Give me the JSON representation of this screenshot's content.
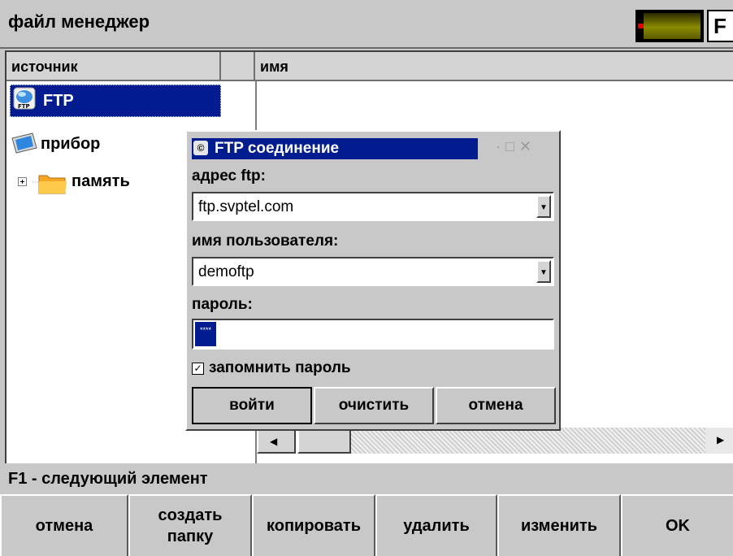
{
  "app": {
    "title": "файл менеджер",
    "f_key": "F"
  },
  "columns": {
    "source": "источник",
    "name": "имя"
  },
  "tree": [
    {
      "label": "FTP",
      "icon": "ftp-icon",
      "selected": true
    },
    {
      "label": "прибор",
      "icon": "device-icon",
      "selected": false
    },
    {
      "label": "память",
      "icon": "folder-icon",
      "expander": "+",
      "selected": false
    }
  ],
  "status_line": "F1 - следующий элемент",
  "fkeys": [
    "отмена",
    "создать папку",
    "копировать",
    "удалить",
    "изменить",
    "OK"
  ],
  "dialog": {
    "title": "FTP соединение",
    "ftp_address_label": "адрес ftp:",
    "ftp_address_value": "ftp.svptel.com",
    "username_label": "имя пользователя:",
    "username_value": "demoftp",
    "password_label": "пароль:",
    "password_value": "****",
    "remember_label": "запомнить пароль",
    "remember_checked": true,
    "buttons": {
      "login": "войти",
      "clear": "очистить",
      "cancel": "отмена"
    }
  },
  "colors": {
    "selection": "#001c8e",
    "background": "#c8c8c8"
  }
}
